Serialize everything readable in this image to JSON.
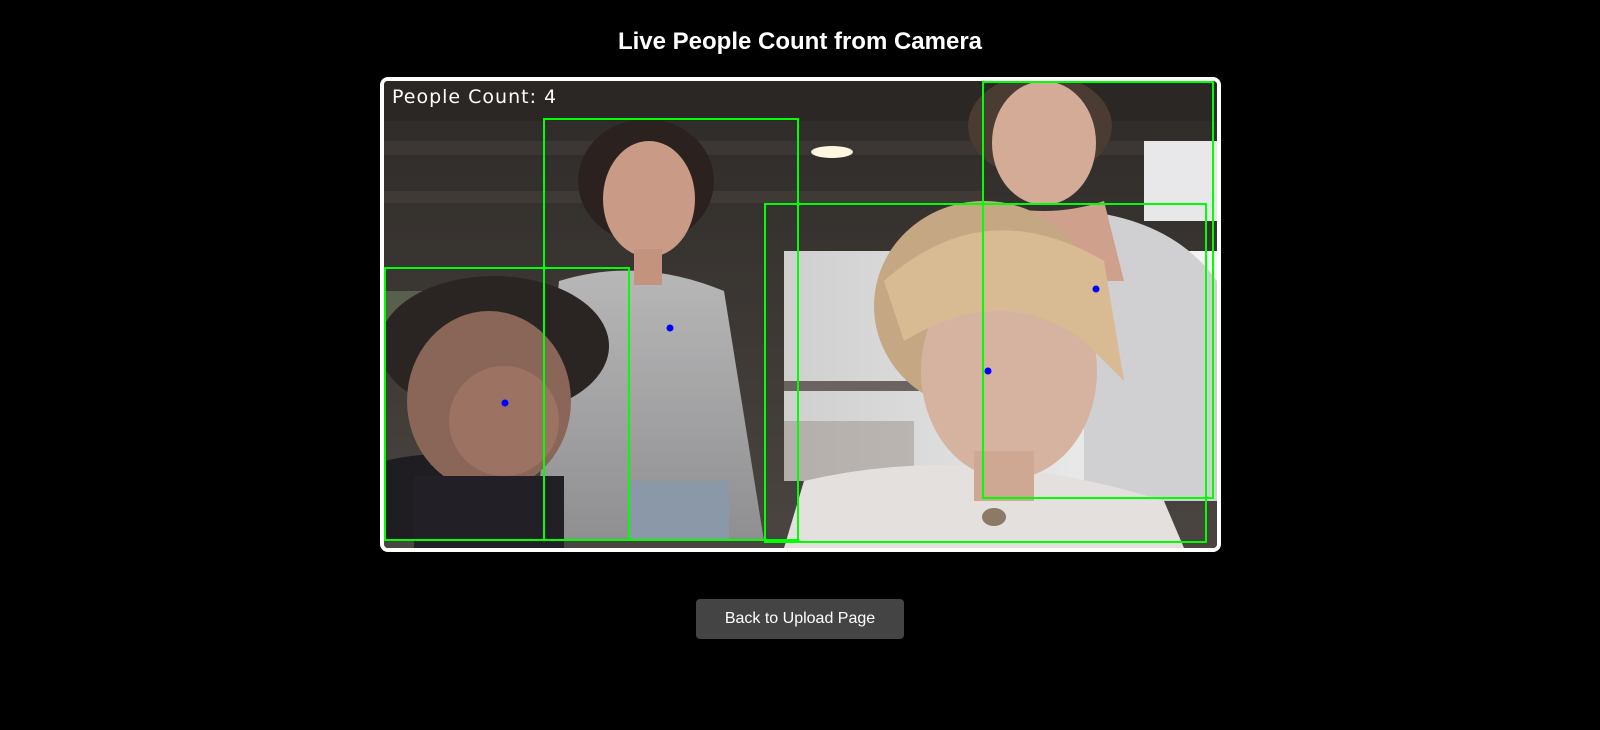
{
  "page": {
    "title": "Live People Count from Camera"
  },
  "camera": {
    "overlay_text": "People Count: 4",
    "people_count": 4,
    "detections": [
      {
        "label": "person-1"
      },
      {
        "label": "person-2"
      },
      {
        "label": "person-3"
      },
      {
        "label": "person-4"
      }
    ]
  },
  "actions": {
    "back_label": "Back to Upload Page"
  },
  "colors": {
    "background": "#000000",
    "box_stroke": "#00ff00",
    "center_dot": "#0000ff",
    "button_bg": "#444444",
    "frame_border": "#ffffff"
  }
}
